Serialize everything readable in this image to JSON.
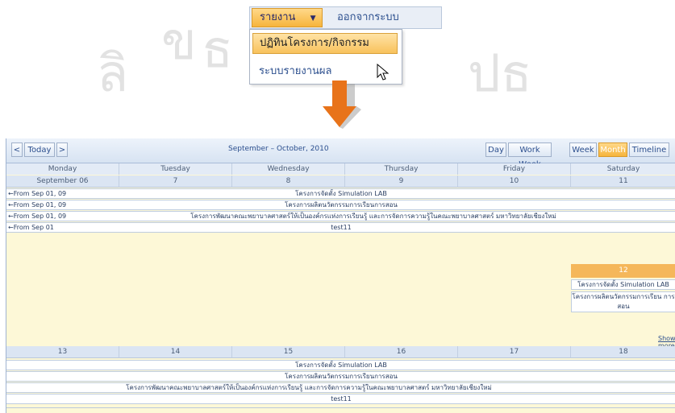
{
  "menu": {
    "report_label": "รายงาน",
    "report_arrow": "▼",
    "logout_label": "ออกจากระบบ"
  },
  "dropdown": {
    "item1": "ปฏิทินโครงการ/กิจกรรม",
    "item2": "ระบบรายงานผล"
  },
  "watermark": [
    "ลิ",
    "ข",
    "ธ",
    "ปธ"
  ],
  "calendar": {
    "prev": "<",
    "today": "Today",
    "next": ">",
    "range": "September – October, 2010",
    "views": [
      "Day",
      "Work Week",
      "Week",
      "Month",
      "Timeline"
    ],
    "days": [
      "Monday",
      "Tuesday",
      "Wednesday",
      "Thursday",
      "Friday",
      "Saturday"
    ],
    "week1_nums": [
      "September 06",
      "7",
      "8",
      "9",
      "10",
      "11"
    ],
    "week2_nums": [
      "13",
      "14",
      "15",
      "16",
      "17",
      "18"
    ],
    "from_labels": [
      "From Sep 01, 09",
      "From Sep 01, 09",
      "From Sep 01, 09",
      "From Sep 01"
    ],
    "events": [
      "โครงการจัดตั้ง Simulation LAB",
      "โครงการผลิตนวัตกรรมการเรียนการสอน",
      "โครงการพัฒนาคณะพยาบาลศาสตร์ให้เป็นองค์กรแห่งการเรียนรู้ และการจัดการความรู้ในคณะพยาบาลศาสตร์ มหาวิทยาลัยเชียงใหม่",
      "test11"
    ],
    "cell12_num": "12",
    "cell12_events": [
      "โครงการจัดตั้ง Simulation LAB",
      "โครงการผลิตนวัตกรรมการเรียน การสอน"
    ],
    "show_more": "Show more"
  }
}
